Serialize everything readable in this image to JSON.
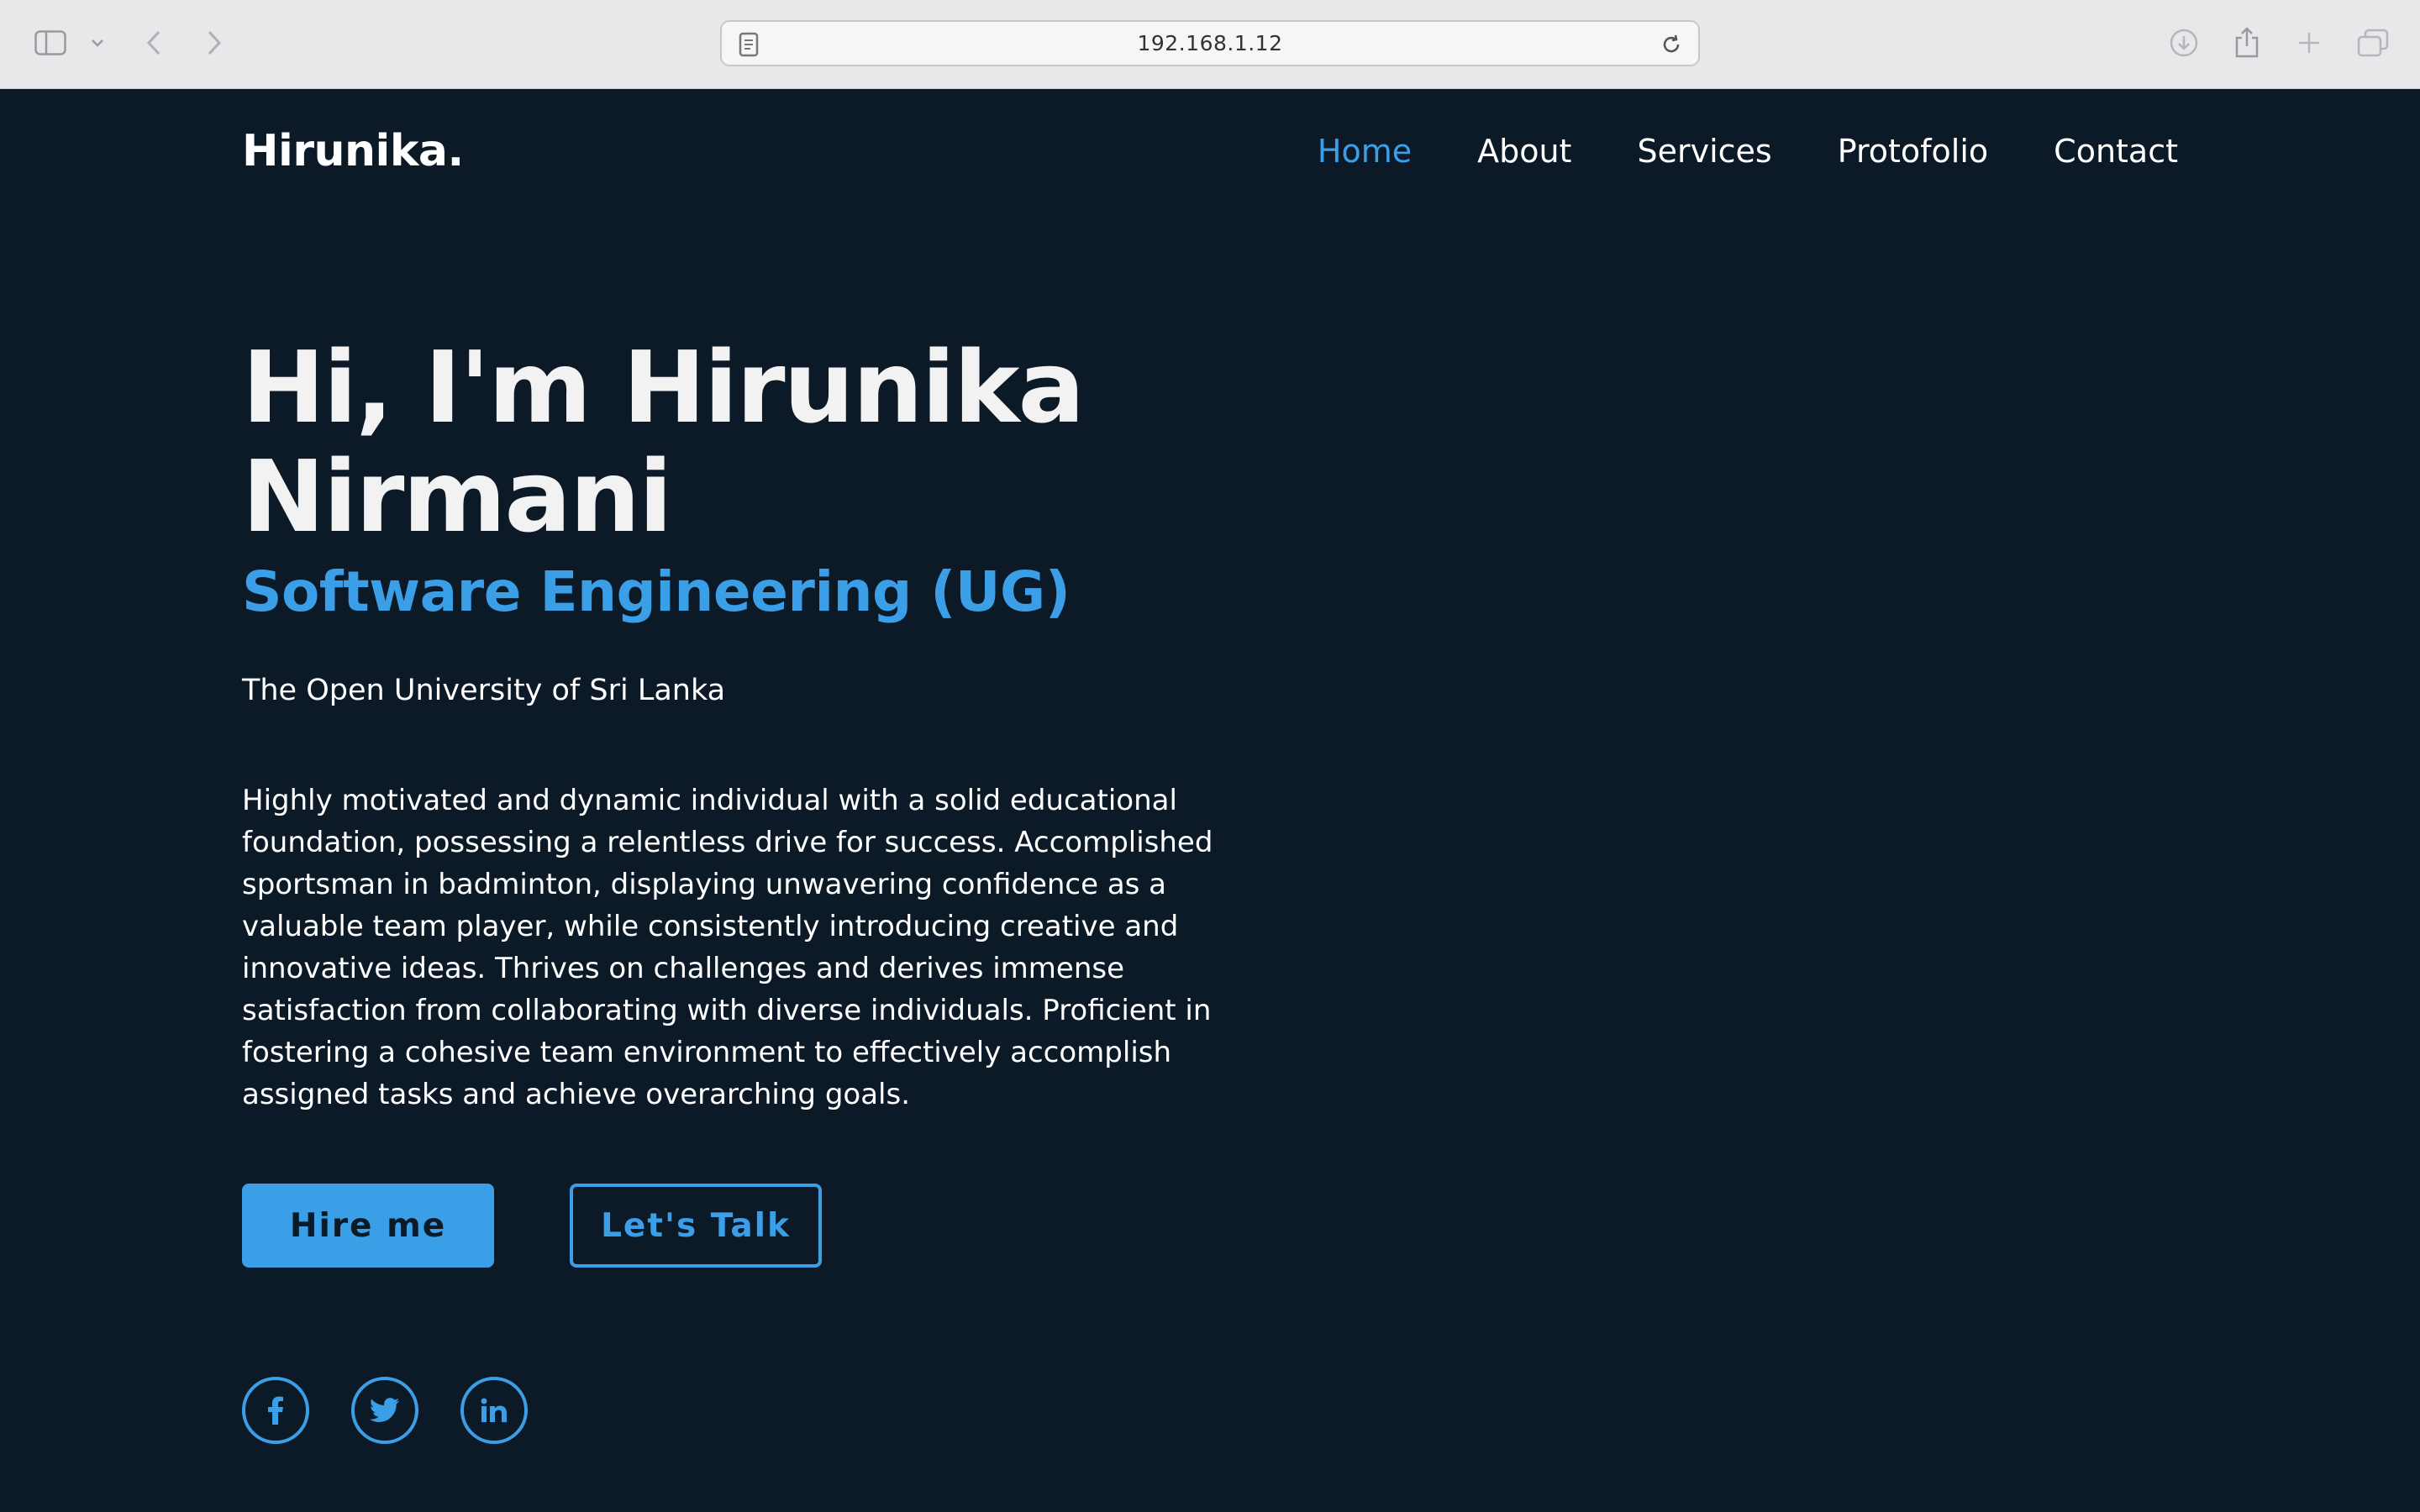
{
  "browser": {
    "url": "192.168.1.12"
  },
  "site": {
    "logo": "Hirunika.",
    "nav": [
      {
        "label": "Home",
        "active": true
      },
      {
        "label": "About",
        "active": false
      },
      {
        "label": "Services",
        "active": false
      },
      {
        "label": "Protofolio",
        "active": false
      },
      {
        "label": "Contact",
        "active": false
      }
    ]
  },
  "hero": {
    "title_line1": "Hi, I'm Hirunika",
    "title_line2": "Nirmani",
    "subtitle": "Software Engineering (UG)",
    "school": "The Open University of Sri Lanka",
    "bio": "Highly motivated and dynamic individual with a solid educational foundation, possessing a relentless drive for success. Accomplished sportsman in badminton, displaying unwavering confidence as a valuable team player, while consistently introducing creative and innovative ideas. Thrives on challenges and derives immense satisfaction from collaborating with diverse individuals. Proficient in fostering a cohesive team environment to effectively accomplish assigned tasks and achieve overarching goals.",
    "hire_label": "Hire me",
    "talk_label": "Let's Talk"
  },
  "socials": [
    {
      "icon": "facebook-icon"
    },
    {
      "icon": "twitter-icon"
    },
    {
      "icon": "linkedin-icon"
    }
  ],
  "colors": {
    "background": "#0c1a28",
    "accent": "#3b9fe8",
    "text": "#ffffff"
  }
}
